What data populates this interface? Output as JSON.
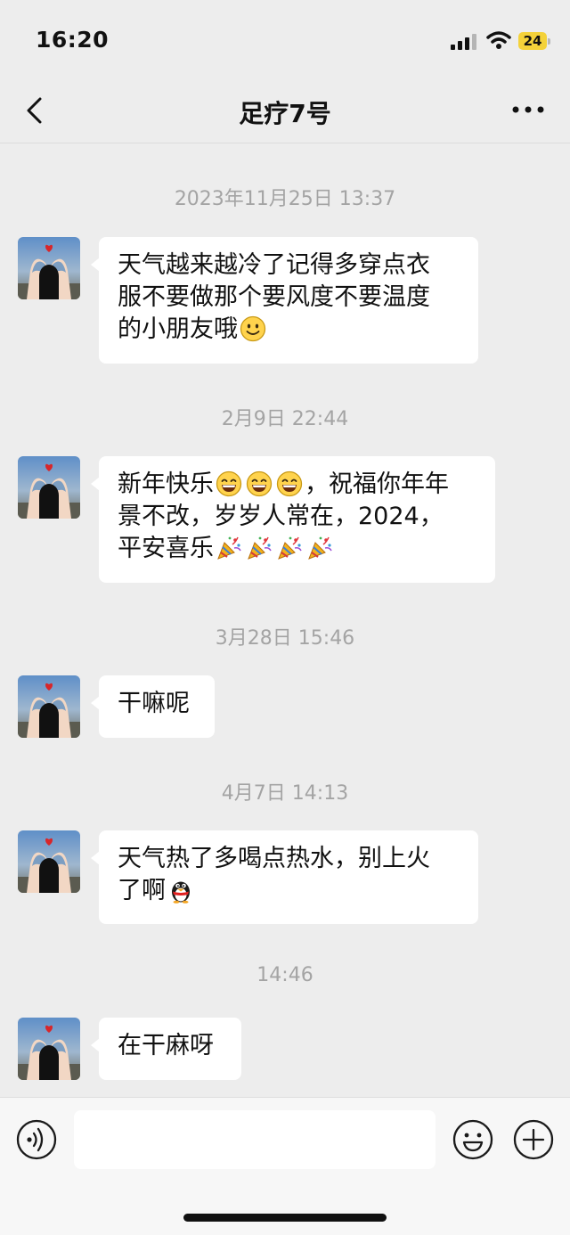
{
  "status_bar": {
    "time": "16:20",
    "battery_level": "24",
    "battery_color": "#f4d23a"
  },
  "nav": {
    "title": "足疗7号",
    "back_icon": "chevron-left-icon",
    "more_icon": "more-dots-icon"
  },
  "messages": [
    {
      "timestamp": "2023年11月25日 13:37",
      "lines": [
        "天气越来越冷了记得多穿点衣",
        "服不要做那个要风度不要温度",
        "的小朋友哦"
      ],
      "emojis": [
        "smile-emoji"
      ]
    },
    {
      "timestamp": "2月9日 22:44",
      "lines": [
        "新年快乐",
        "，祝福你年年",
        "景不改，岁岁人常在，2024，",
        "平安喜乐"
      ],
      "emojis": [
        "grin-emoji",
        "grin-emoji",
        "grin-emoji",
        "party-popper-emoji",
        "party-popper-emoji",
        "party-popper-emoji",
        "party-popper-emoji"
      ]
    },
    {
      "timestamp": "3月28日 15:46",
      "lines": [
        "干嘛呢"
      ],
      "emojis": []
    },
    {
      "timestamp": "4月7日 14:13",
      "lines": [
        "天气热了多喝点热水，别上火",
        "了啊"
      ],
      "emojis": [
        "penguin-emoji"
      ]
    },
    {
      "timestamp": "14:46",
      "lines": [
        "在干麻呀"
      ],
      "emojis": []
    }
  ],
  "input_bar": {
    "placeholder": "",
    "voice_icon": "voice-icon",
    "emoji_icon": "emoji-face-icon",
    "plus_icon": "plus-circle-icon"
  },
  "colors": {
    "background": "#ededed",
    "bubble": "#ffffff",
    "timestamp": "#a4a4a4"
  }
}
